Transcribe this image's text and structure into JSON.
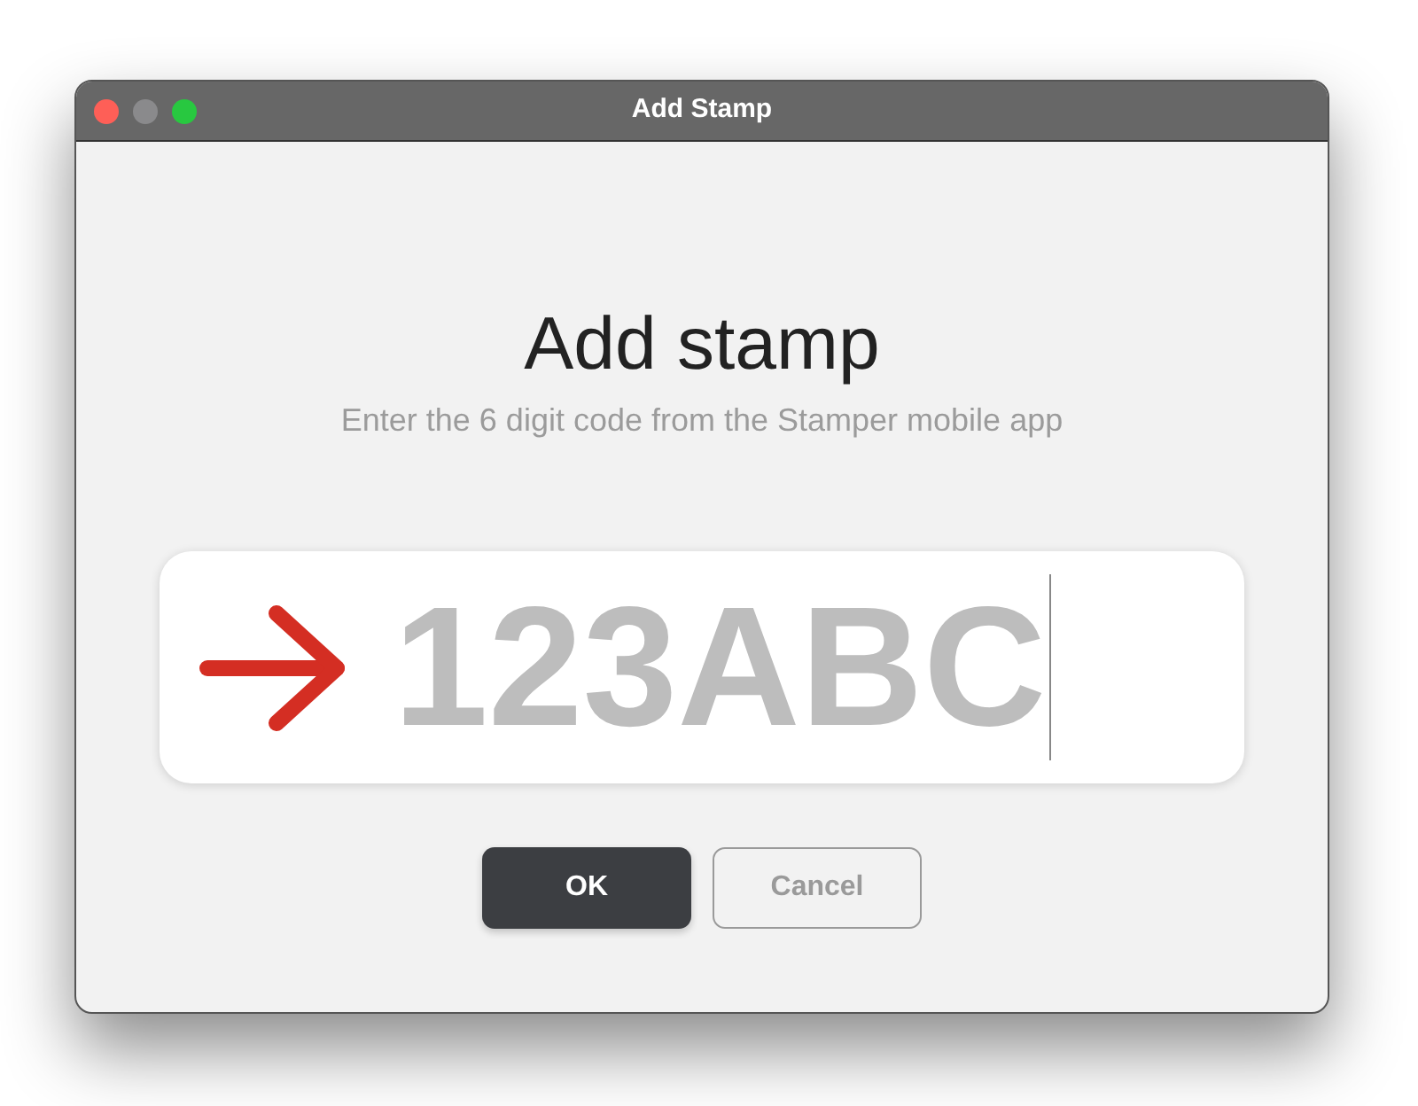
{
  "window": {
    "title": "Add Stamp"
  },
  "heading": "Add stamp",
  "subtitle": "Enter the 6 digit code from the Stamper mobile app",
  "code_field": {
    "value": "123ABC",
    "focused": true
  },
  "buttons": [
    {
      "label": "OK",
      "kind": "primary"
    },
    {
      "label": "Cancel",
      "kind": "secondary"
    }
  ]
}
